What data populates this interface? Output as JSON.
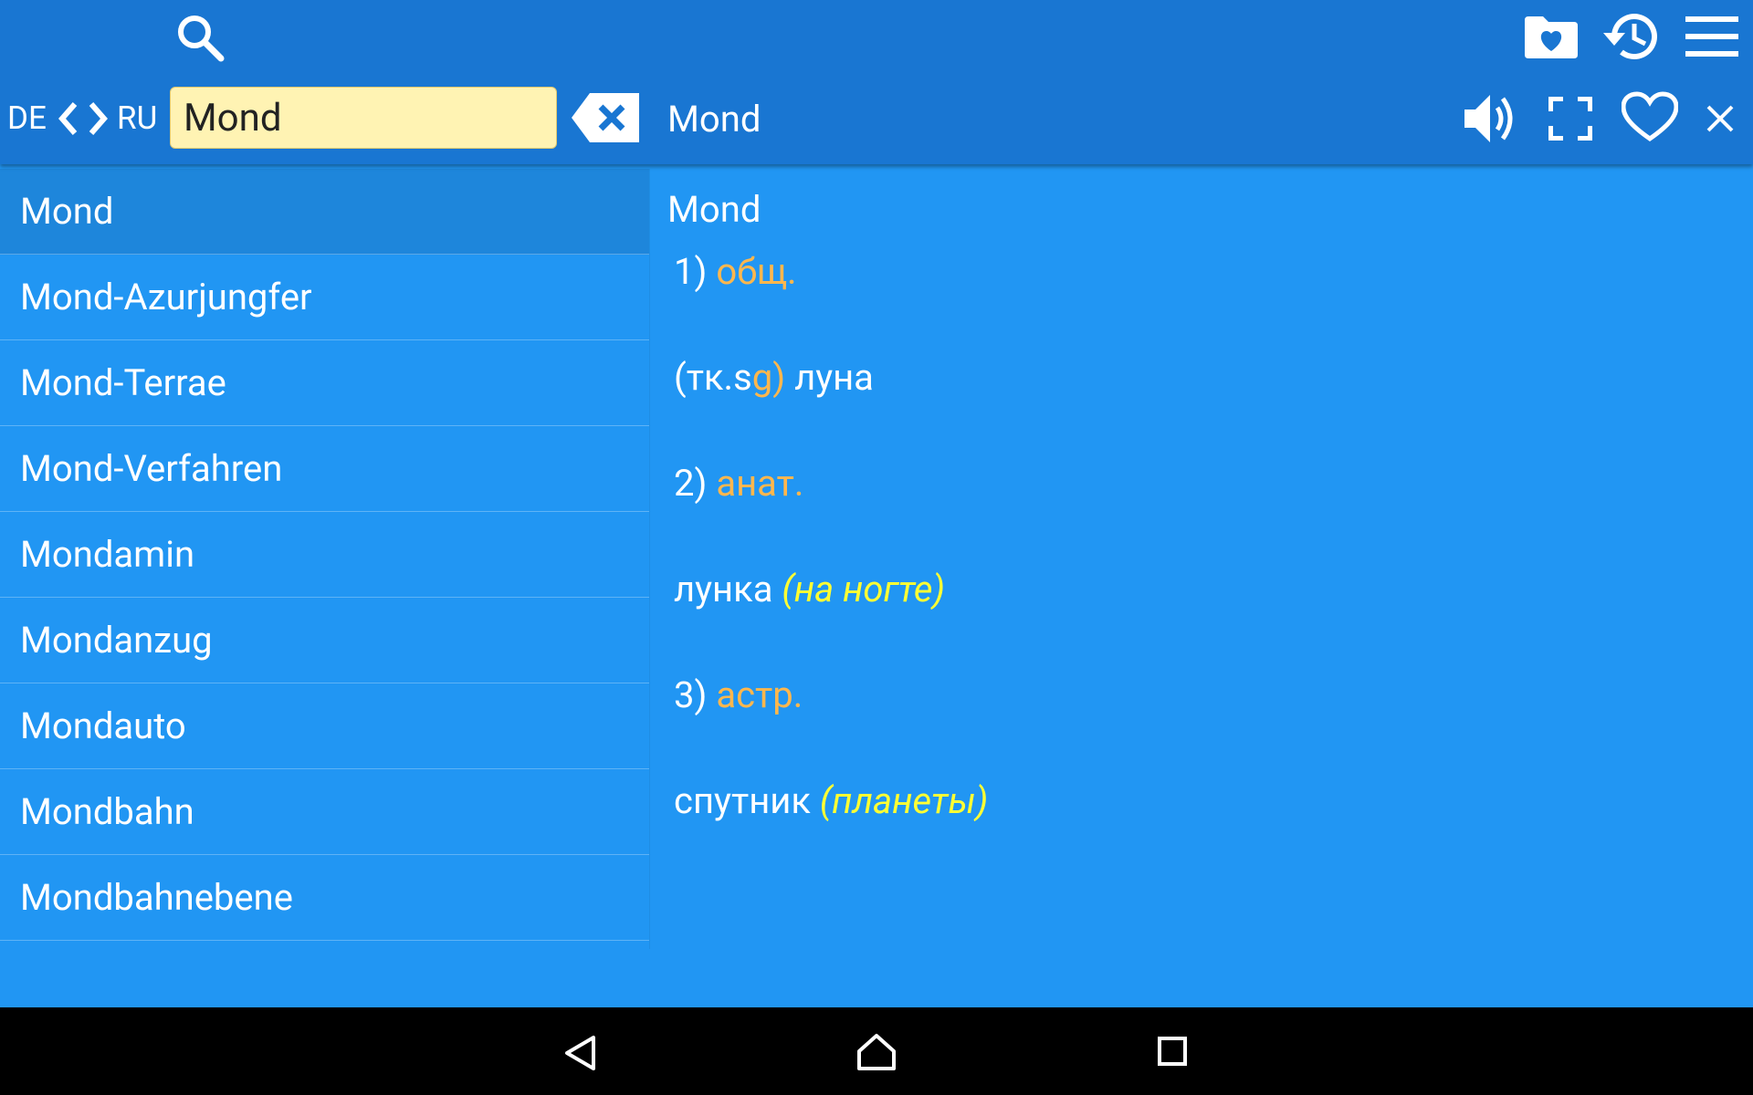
{
  "toolbar": {
    "lang_from": "DE",
    "lang_to": "RU",
    "search_value": "Mond"
  },
  "detail_header": {
    "title": "Mond"
  },
  "word_list": [
    {
      "label": "Mond",
      "selected": true
    },
    {
      "label": "Mond-Azurjungfer"
    },
    {
      "label": "Mond-Terrae"
    },
    {
      "label": "Mond-Verfahren"
    },
    {
      "label": "Mondamin"
    },
    {
      "label": "Mondanzug"
    },
    {
      "label": "Mondauto"
    },
    {
      "label": "Mondbahn"
    },
    {
      "label": "Mondbahnebene"
    }
  ],
  "entry": {
    "headword": "Mond",
    "senses": [
      {
        "num": "1)",
        "label": "общ."
      },
      {
        "pre": "(тк.s",
        "mark": "g)",
        "text": " луна"
      },
      {
        "num": "2)",
        "label": "анат."
      },
      {
        "text": "лунка ",
        "note": "(на ногте)"
      },
      {
        "num": "3)",
        "label": "астр."
      },
      {
        "text": "спутник ",
        "note": "(планеты)"
      }
    ]
  },
  "colors": {
    "toolbar_bg": "#1976D2",
    "content_bg": "#2196F3",
    "label_orange": "#FFB74D",
    "note_yellow": "#FFFF33",
    "search_bg": "#FFF3B3"
  },
  "icons": [
    "search-icon",
    "favorites-folder-icon",
    "history-icon",
    "menu-icon",
    "chevron-left-icon",
    "chevron-right-icon",
    "clear-input-icon",
    "speaker-icon",
    "fullscreen-icon",
    "heart-icon",
    "close-icon",
    "back-icon",
    "home-icon",
    "recents-icon"
  ]
}
